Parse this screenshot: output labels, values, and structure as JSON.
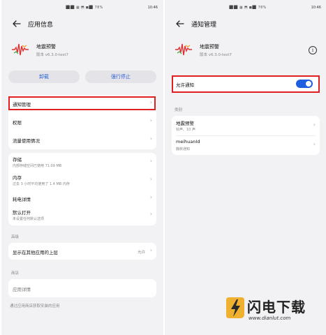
{
  "colors": {
    "accent": "#1e5fe0",
    "highlight": "#e02020",
    "button_text": "#2a5fd6"
  },
  "left": {
    "status_icons": "⬛⬛ ▦ ⬒ ◼⬛ 78%",
    "status_time": "10:46",
    "title": "应用信息",
    "app": {
      "name": "地震预警",
      "version": "版本 v6.3.0-test7"
    },
    "buttons": {
      "uninstall": "卸载",
      "force_stop": "强行停止"
    },
    "rows": {
      "notifications": "通知管理",
      "permissions": "权限",
      "data_usage": "流量使用情况",
      "storage": "存储",
      "storage_sub": "内部存储空间已使用 71.09 MB",
      "memory": "内存",
      "memory_sub": "过去 3 小时平均使用了 1.4 MB 内存",
      "battery": "耗电详情",
      "open_default": "默认打开",
      "open_default_sub": "未设置任何默认选项"
    },
    "advanced_label": "高级",
    "overlay": {
      "label": "显示在其他应用的上层",
      "value": "允许"
    },
    "store_label": "商店",
    "app_details": "应用详情",
    "footer": "通过应用商店获取安装的应用"
  },
  "right": {
    "status_icons": "⬛⬛ ▦ ⬒ ◼⬛ 78%",
    "status_time": "10:46",
    "title": "通知管理",
    "app": {
      "name": "地震预警",
      "version": "版本 v6.3.0-test7"
    },
    "allow_label": "允许通知",
    "allow_on": true,
    "category_label": "类别",
    "categories": [
      {
        "name": "地震预警",
        "sub": "铃声、10 声"
      },
      {
        "name": "meihuanId",
        "sub": "静默通知"
      }
    ]
  },
  "watermark": {
    "title": "闪电下载",
    "url": "www.dianlut.com"
  }
}
